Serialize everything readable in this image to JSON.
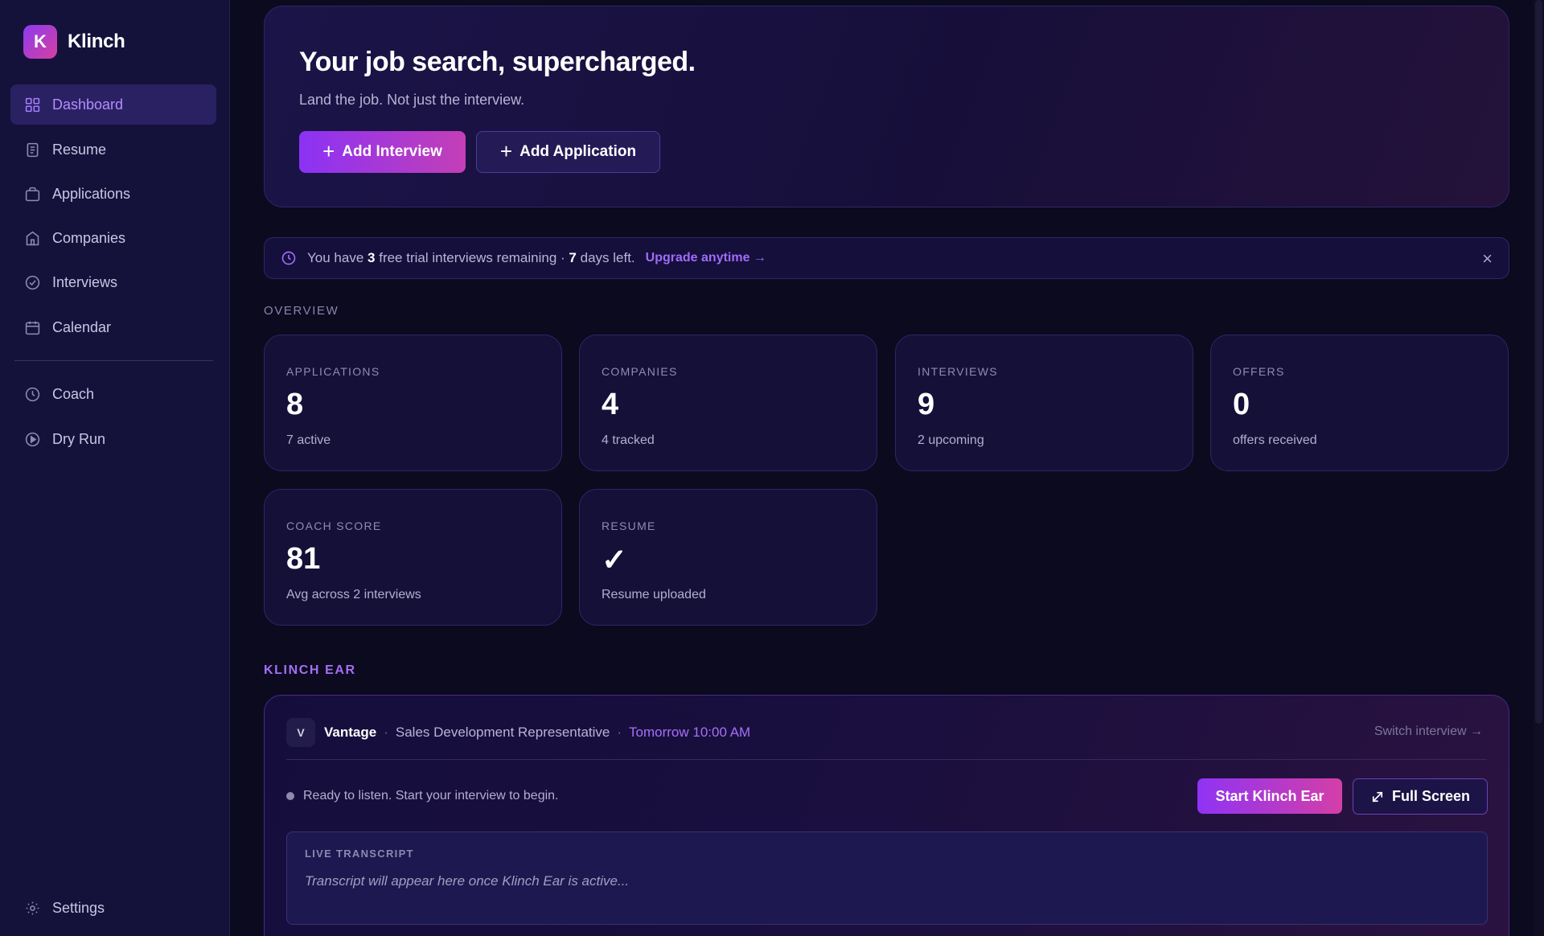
{
  "brand": {
    "logo_letter": "K",
    "name": "Klinch"
  },
  "sidebar": {
    "items": [
      {
        "label": "Dashboard",
        "icon": "grid-icon"
      },
      {
        "label": "Resume",
        "icon": "document-icon"
      },
      {
        "label": "Applications",
        "icon": "briefcase-icon"
      },
      {
        "label": "Companies",
        "icon": "building-icon"
      },
      {
        "label": "Interviews",
        "icon": "check-circle-icon"
      },
      {
        "label": "Calendar",
        "icon": "calendar-icon"
      },
      {
        "label": "Coach",
        "icon": "clock-icon"
      },
      {
        "label": "Dry Run",
        "icon": "play-circle-icon"
      }
    ],
    "settings_label": "Settings"
  },
  "hero": {
    "title": "Your job search, supercharged.",
    "subtitle": "Land the job. Not just the interview.",
    "add_interview_label": "Add Interview",
    "add_application_label": "Add Application"
  },
  "trial": {
    "prefix": "You have",
    "interviews_count": "3",
    "middle": "free trial interviews remaining ·",
    "days_count": "7",
    "suffix": "days left.",
    "upgrade_label": "Upgrade anytime →",
    "close_glyph": "×"
  },
  "overview": {
    "label": "OVERVIEW",
    "cards": [
      {
        "label": "APPLICATIONS",
        "value": "8",
        "sub": "7 active"
      },
      {
        "label": "COMPANIES",
        "value": "4",
        "sub": "4 tracked"
      },
      {
        "label": "INTERVIEWS",
        "value": "9",
        "sub": "2 upcoming"
      },
      {
        "label": "OFFERS",
        "value": "0",
        "sub": "offers received"
      },
      {
        "label": "COACH SCORE",
        "value": "81",
        "sub": "Avg across 2 interviews"
      },
      {
        "label": "RESUME",
        "value": "✓",
        "sub": "Resume uploaded"
      }
    ]
  },
  "klinch_ear": {
    "label": "KLINCH EAR",
    "avatar_letter": "V",
    "company": "Vantage",
    "separator": "·",
    "role": "Sales Development Representative",
    "time": "Tomorrow 10:00 AM",
    "switch_label": "Switch interview →",
    "status": "Ready to listen. Start your interview to begin.",
    "start_label": "Start Klinch Ear",
    "fullscreen_label": "Full Screen",
    "transcript_label": "LIVE TRANSCRIPT",
    "transcript_placeholder": "Transcript will appear here once Klinch Ear is active..."
  },
  "colors": {
    "background": "#0b0a1f",
    "sidebar": "#14123a",
    "accent": "#9f6cf7",
    "brand_gradient_start": "#8b3cf0",
    "brand_gradient_end": "#d63ea0"
  }
}
